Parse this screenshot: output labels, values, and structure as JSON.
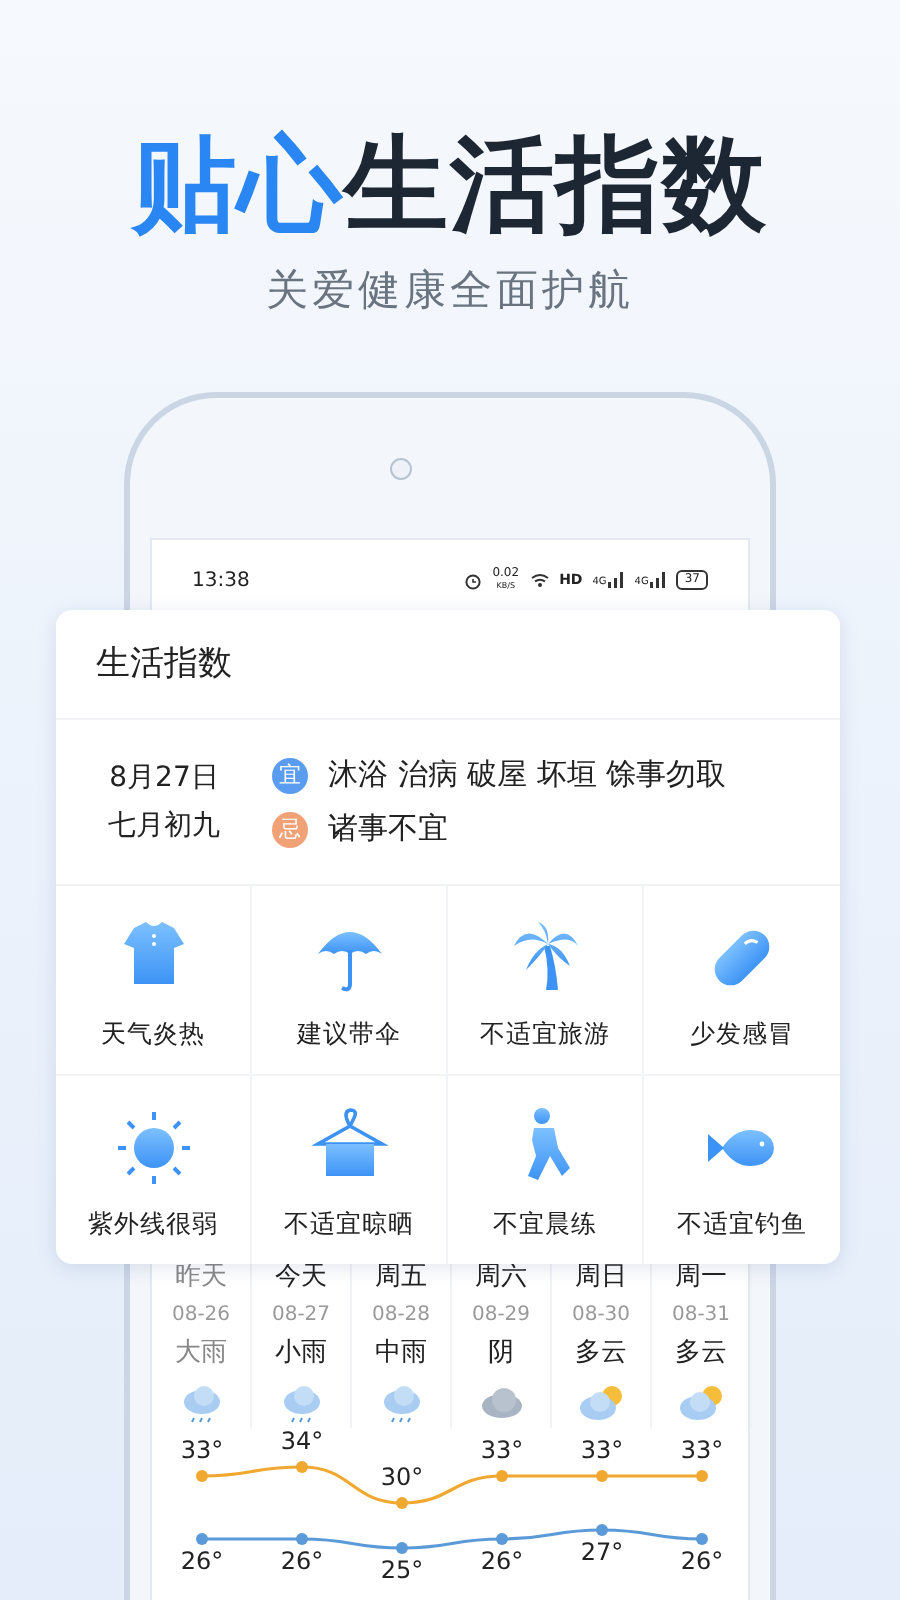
{
  "headline": [
    {
      "text": "贴心",
      "accent": true
    },
    {
      "text": "生活指数",
      "accent": false
    }
  ],
  "subtitle": "关爱健康全面护航",
  "status_bar": {
    "time": "13:38",
    "speed": "0.02",
    "speed_unit": "KB/S",
    "hd": "HD",
    "networks": [
      "4G",
      "4G"
    ],
    "battery": "37"
  },
  "card": {
    "title": "生活指数",
    "date": "8月27日",
    "lunar_date": "七月初九",
    "almanac": [
      {
        "badge": "宜",
        "color": "#5a9cf0",
        "text": "沐浴 治病 破屋 坏垣 馀事勿取"
      },
      {
        "badge": "忌",
        "color": "#f0a276",
        "text": "诸事不宜"
      }
    ],
    "indices": [
      {
        "label": "天气炎热"
      },
      {
        "label": "建议带伞"
      },
      {
        "label": "不适宜旅游"
      },
      {
        "label": "少发感冒"
      },
      {
        "label": "紫外线很弱"
      },
      {
        "label": "不适宜晾晒"
      },
      {
        "label": "不宜晨练"
      },
      {
        "label": "不适宜钓鱼"
      }
    ]
  },
  "forecast": {
    "days": [
      {
        "name": "昨天",
        "weather": "大雨",
        "kind": "rain",
        "past": true
      },
      {
        "name": "今天",
        "weather": "小雨",
        "kind": "rain",
        "past": false
      },
      {
        "name": "周五",
        "weather": "中雨",
        "kind": "rain",
        "past": false
      },
      {
        "name": "周六",
        "weather": "阴",
        "kind": "overcast",
        "past": false
      },
      {
        "name": "周日",
        "weather": "多云",
        "kind": "partly-cloudy",
        "past": false
      },
      {
        "name": "周一",
        "weather": "多云",
        "kind": "partly-cloudy",
        "past": false
      }
    ],
    "chart_data": {
      "type": "line",
      "categories": [
        "08-26",
        "08-27",
        "08-28",
        "08-29",
        "08-30",
        "08-31"
      ],
      "series": [
        {
          "color": "#f0a830",
          "marker": "o",
          "values": [
            33,
            34,
            30,
            33,
            33,
            33
          ],
          "value_labels": [
            "33°",
            "34°",
            "30°",
            "33°",
            "33°",
            "33°"
          ]
        },
        {
          "color": "#5a9ad8",
          "marker": "o",
          "values": [
            26,
            26,
            25,
            26,
            27,
            26
          ],
          "value_labels": [
            "26°",
            "26°",
            "25°",
            "26°",
            "27°",
            "26°"
          ]
        }
      ]
    }
  }
}
